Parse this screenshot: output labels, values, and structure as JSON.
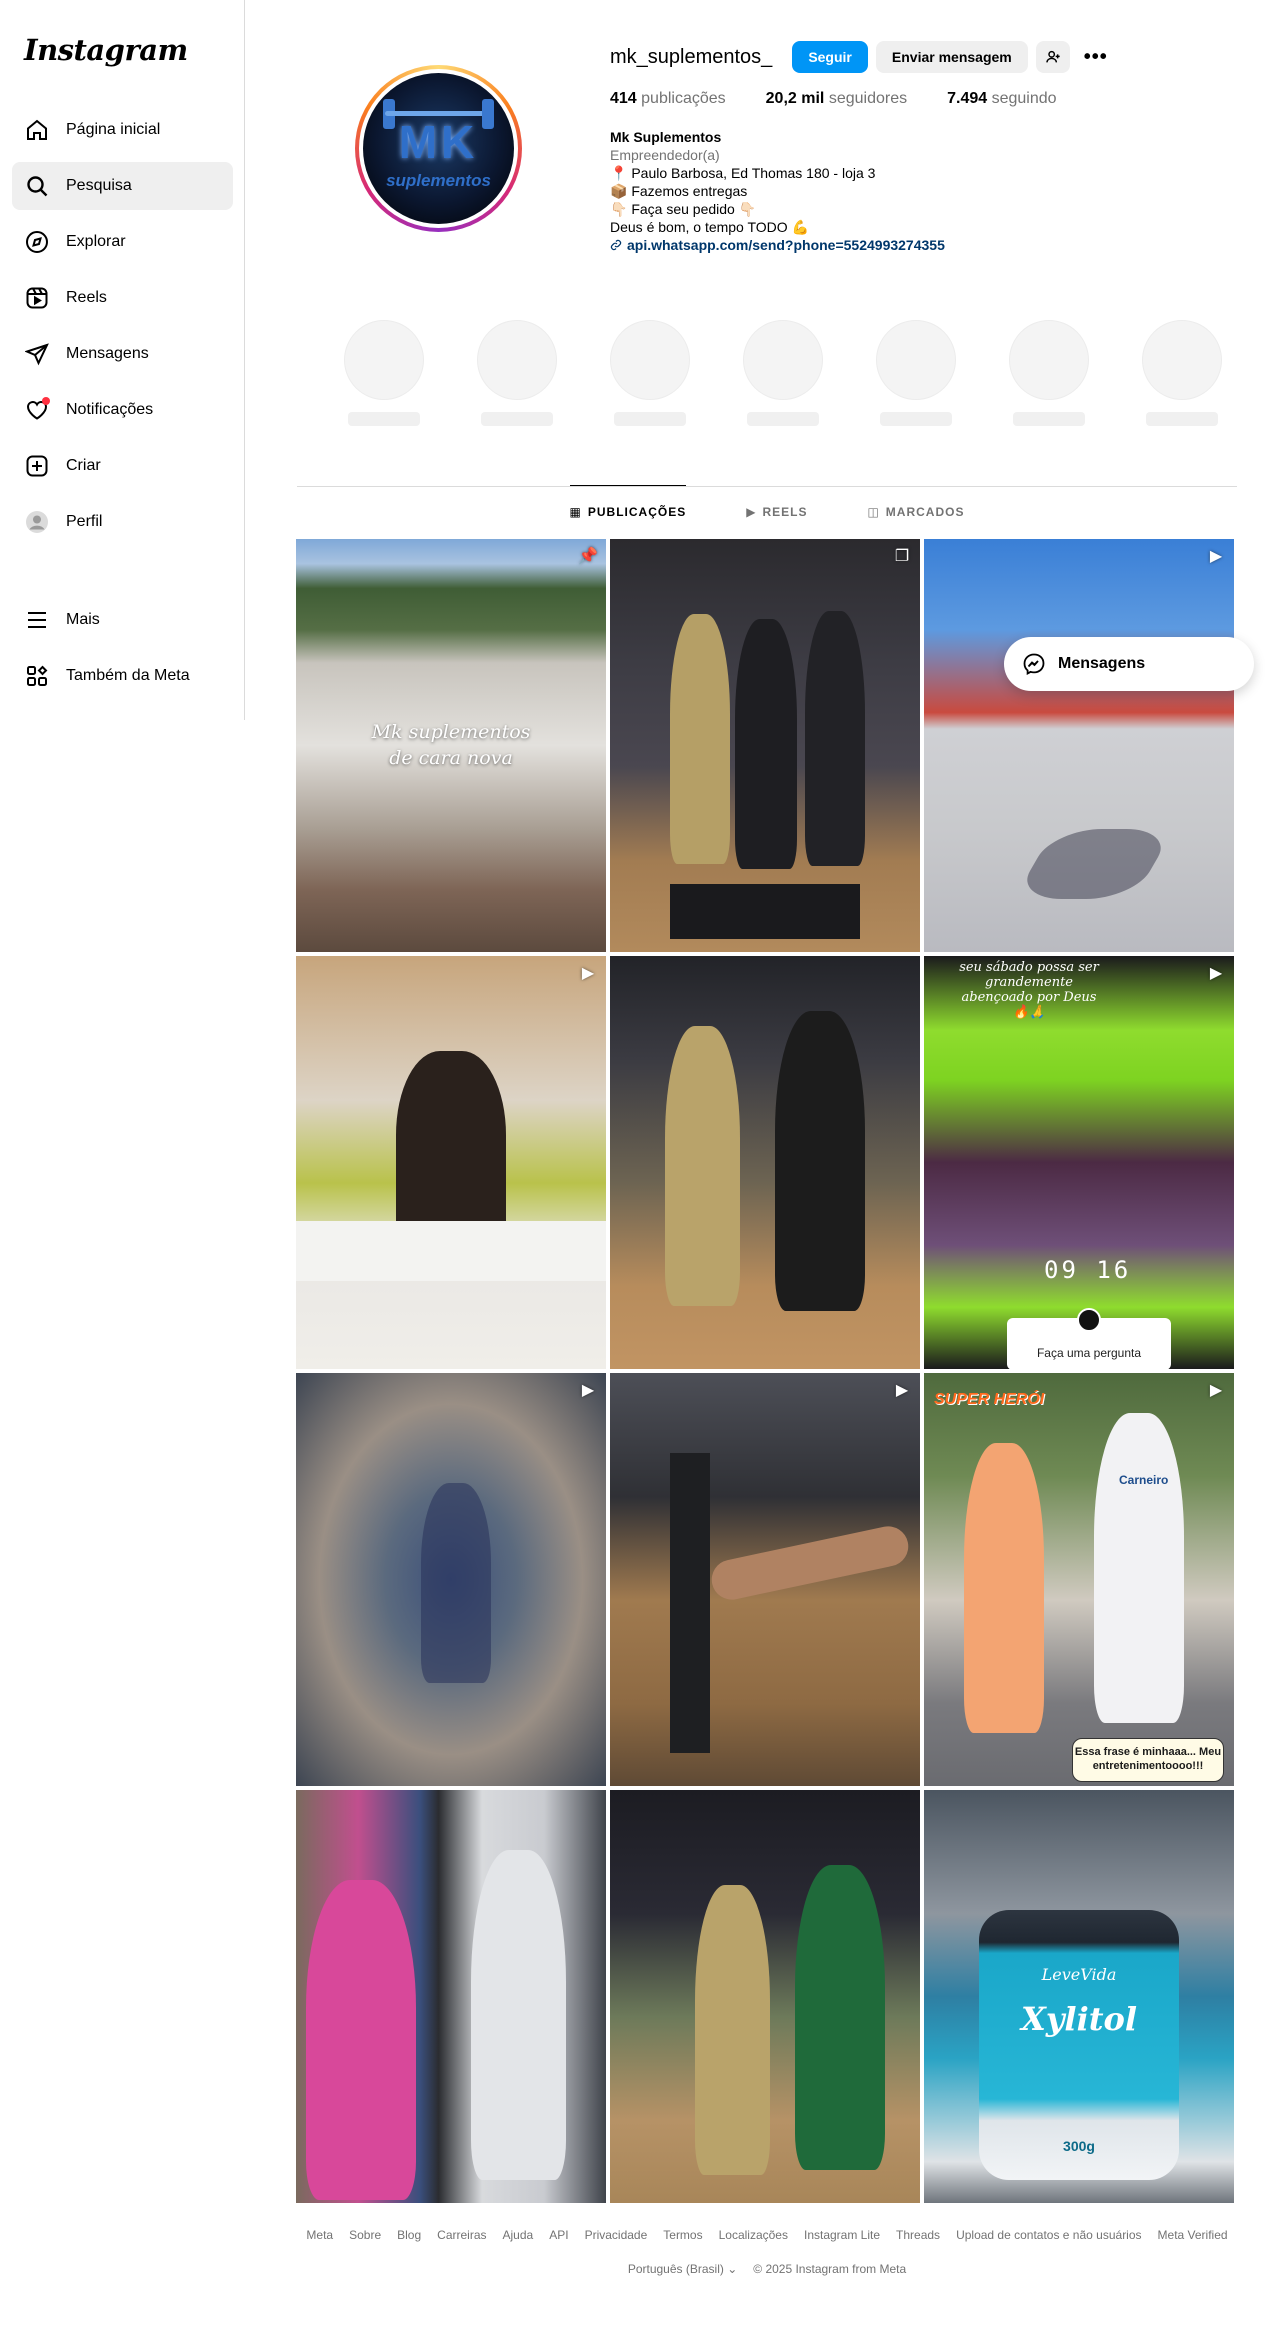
{
  "app": {
    "logo": "Instagram"
  },
  "sidebar": {
    "items": [
      {
        "label": "Página inicial",
        "icon": "home-icon"
      },
      {
        "label": "Pesquisa",
        "icon": "search-icon",
        "active": true
      },
      {
        "label": "Explorar",
        "icon": "compass-icon"
      },
      {
        "label": "Reels",
        "icon": "reels-icon"
      },
      {
        "label": "Mensagens",
        "icon": "send-icon"
      },
      {
        "label": "Notificações",
        "icon": "heart-icon"
      },
      {
        "label": "Criar",
        "icon": "plus-square-icon"
      },
      {
        "label": "Perfil",
        "icon": "profile-avatar-icon"
      }
    ],
    "bottom": [
      {
        "label": "Mais",
        "icon": "menu-icon"
      },
      {
        "label": "Também da Meta",
        "icon": "meta-apps-icon"
      }
    ]
  },
  "profile": {
    "username": "mk_suplementos_",
    "follow_label": "Seguir",
    "message_label": "Enviar mensagem",
    "more_label": "•••",
    "avatar_text_main": "MK",
    "avatar_text_sub": "suplementos",
    "stats": [
      {
        "value": "414",
        "label": "publicações"
      },
      {
        "value": "20,2 mil",
        "label": "seguidores"
      },
      {
        "value": "7.494",
        "label": "seguindo"
      }
    ],
    "bio": {
      "name": "Mk Suplementos",
      "category": "Empreendedor(a)",
      "lines": [
        "📍 Paulo Barbosa, Ed Thomas 180 - loja 3",
        "📦 Fazemos entregas",
        "👇🏻 Faça seu pedido 👇🏻",
        "Deus é bom, o tempo TODO 💪"
      ],
      "link": "api.whatsapp.com/send?phone=5524993274355"
    }
  },
  "tabs": [
    {
      "label": "PUBLICAÇÕES",
      "icon": "▦",
      "active": true
    },
    {
      "label": "REELS",
      "icon": "▶"
    },
    {
      "label": "MARCADOS",
      "icon": "◫"
    }
  ],
  "posts": {
    "p0_caption_1": "Mk suplementos",
    "p0_caption_2": "de cara nova",
    "p5_overlay": "seu sábado possa ser grandemente abençoado por Deus 🔥🙏",
    "p5_timer": "09 16",
    "p5_ask": "Faça uma pergunta",
    "p8_title": "SUPER HERÓI",
    "p8_shirt": "Carneiro",
    "p8_speech": "Essa frase é minhaaa... Meu entretenimentoooo!!!",
    "p11_brand": "LeveVida",
    "p11_product": "Xylitol",
    "p11_weight": "300g"
  },
  "floating_messages": {
    "label": "Mensagens"
  },
  "footer": {
    "links": [
      "Meta",
      "Sobre",
      "Blog",
      "Carreiras",
      "Ajuda",
      "API",
      "Privacidade",
      "Termos",
      "Localizações",
      "Instagram Lite",
      "Threads",
      "Upload de contatos e não usuários",
      "Meta Verified"
    ],
    "language": "Português (Brasil) ⌄",
    "copyright": "© 2025 Instagram from Meta"
  }
}
